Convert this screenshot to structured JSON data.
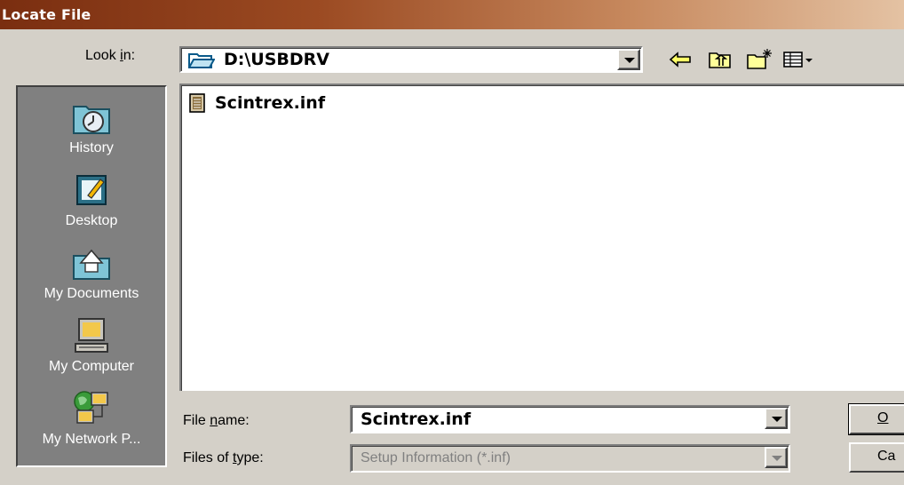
{
  "window": {
    "title": "Locate File"
  },
  "lookin": {
    "label_pre": "Look ",
    "label_key": "i",
    "label_post": "n:",
    "value": "D:\\USBDRV"
  },
  "toolbar": {
    "icons": [
      "back-icon",
      "up-folder-icon",
      "new-folder-icon",
      "view-menu-icon"
    ]
  },
  "places": [
    {
      "label": "History",
      "icon": "history-icon"
    },
    {
      "label": "Desktop",
      "icon": "desktop-icon"
    },
    {
      "label": "My Documents",
      "icon": "my-documents-icon"
    },
    {
      "label": "My Computer",
      "icon": "my-computer-icon"
    },
    {
      "label": "My Network P...",
      "icon": "my-network-places-icon"
    }
  ],
  "files": [
    {
      "name": "Scintrex.inf",
      "icon": "inf-file-icon"
    }
  ],
  "filename": {
    "label_pre": "File ",
    "label_key": "n",
    "label_post": "ame:",
    "value": "Scintrex.inf"
  },
  "filetype": {
    "label_pre": "Files of ",
    "label_key": "t",
    "label_post": "ype:",
    "value": "Setup Information (*.inf)"
  },
  "buttons": {
    "open": "O",
    "cancel": "Ca"
  },
  "colors": {
    "title_start": "#7a2e10",
    "title_end": "#e4c2a3",
    "face": "#d4d0c8",
    "places_bg": "#808080"
  }
}
